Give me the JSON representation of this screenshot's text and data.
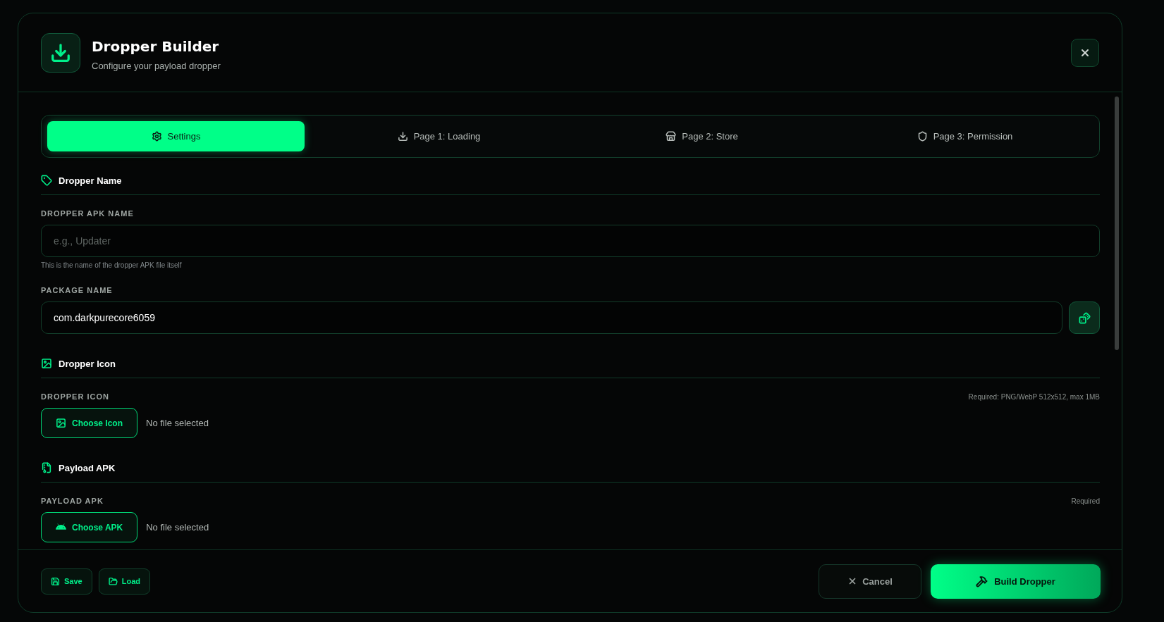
{
  "dialog": {
    "title": "Dropper Builder",
    "subtitle": "Configure your payload dropper"
  },
  "tabs": [
    {
      "label": "Settings",
      "selected": true
    },
    {
      "label": "Page 1: Loading",
      "selected": false
    },
    {
      "label": "Page 2: Store",
      "selected": false
    },
    {
      "label": "Page 3: Permission",
      "selected": false
    }
  ],
  "sections": [
    {
      "title": "Dropper Name",
      "fields": [
        {
          "kind": "text",
          "label": "DROPPER APK NAME",
          "placeholder": "e.g., Updater",
          "hint": "This is the name of the dropper APK file itself"
        },
        {
          "kind": "text-generate",
          "label": "PACKAGE NAME",
          "value": "com.darkpurecore6059"
        }
      ]
    },
    {
      "title": "Dropper Icon",
      "fields": [
        {
          "kind": "file",
          "label": "DROPPER ICON",
          "note": "Required: PNG/WebP 512x512, max 1MB",
          "button": "Choose Icon",
          "status": "No file selected"
        }
      ]
    },
    {
      "title": "Payload APK",
      "fields": [
        {
          "kind": "file",
          "label": "PAYLOAD APK",
          "note": "Required",
          "button": "Choose APK",
          "status": "No file selected"
        }
      ]
    }
  ],
  "footer": {
    "left_buttons": [
      "Save",
      "Load"
    ],
    "cancel": "Cancel",
    "primary": "Build Dropper"
  }
}
